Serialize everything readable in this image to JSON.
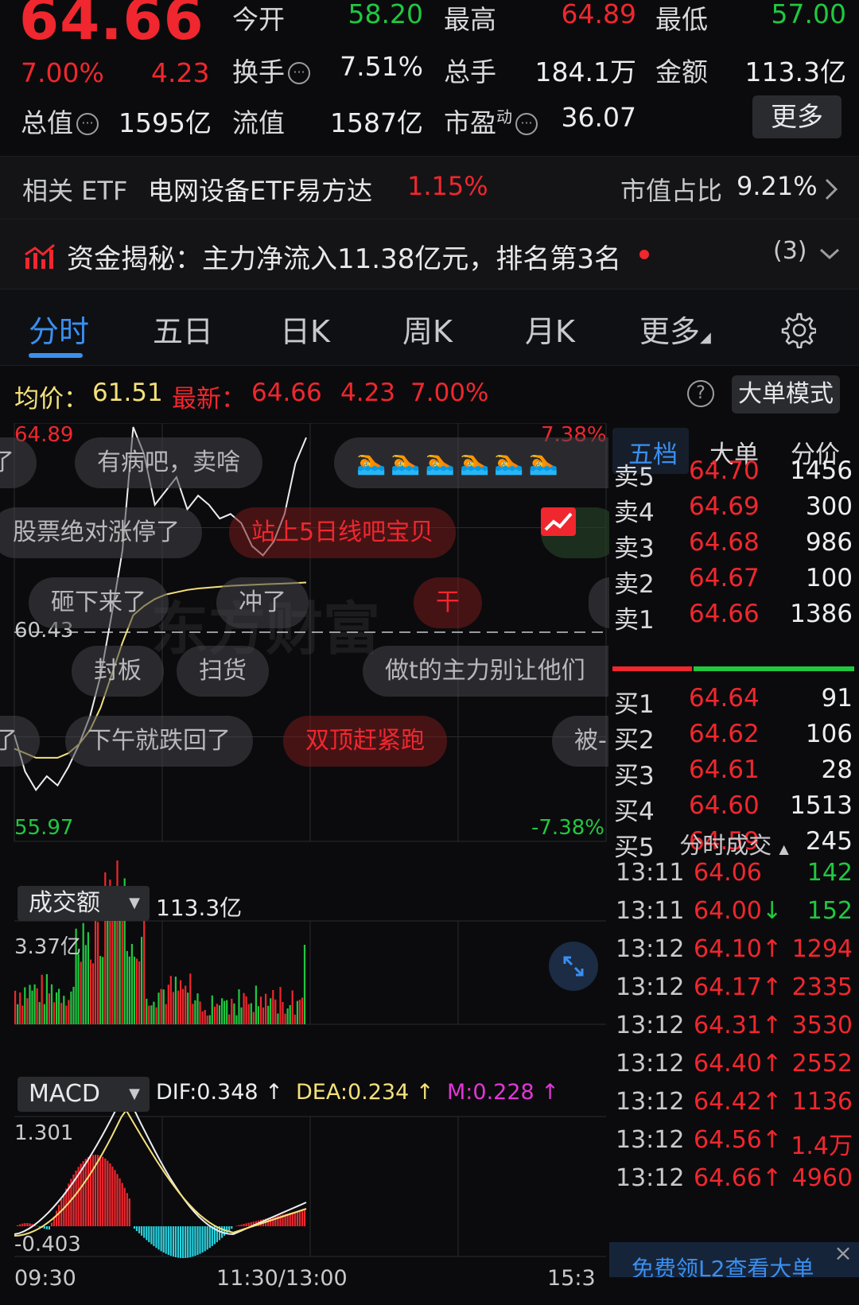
{
  "header": {
    "price": "64.66",
    "change_pct": "7.00%",
    "change_amt": "4.23",
    "row1": [
      {
        "label": "今开",
        "value": "58.20",
        "color": "green"
      },
      {
        "label": "最高",
        "value": "64.89",
        "color": "red"
      },
      {
        "label": "最低",
        "value": "57.00",
        "color": "green"
      }
    ],
    "row2": [
      {
        "label": "换手",
        "value": "7.51%",
        "color": "white"
      },
      {
        "label": "总手",
        "value": "184.1万",
        "color": "white"
      },
      {
        "label": "金额",
        "value": "113.3亿",
        "color": "white"
      }
    ],
    "row3": [
      {
        "label": "总值",
        "value": "1595亿",
        "color": "white"
      },
      {
        "label": "流值",
        "value": "1587亿",
        "color": "white"
      },
      {
        "label": "市盈",
        "sup": "动",
        "value": "36.07",
        "color": "white"
      }
    ],
    "more_label": "更多",
    "help_glyph": "···"
  },
  "etf": {
    "label": "相关 ETF",
    "name": "电网设备ETF易方达",
    "pct": "1.15%",
    "share_label": "市值占比",
    "share_value": "9.21%"
  },
  "fund_flow": {
    "text": "资金揭秘：主力净流入11.38亿元，排名第3名",
    "count": "(3)"
  },
  "tabs": [
    {
      "label": "分时",
      "active": true
    },
    {
      "label": "五日",
      "active": false
    },
    {
      "label": "日K",
      "active": false
    },
    {
      "label": "周K",
      "active": false
    },
    {
      "label": "月K",
      "active": false
    },
    {
      "label": "更多",
      "active": false
    }
  ],
  "stats": {
    "avg_label": "均价：",
    "avg_value": "61.51",
    "last_label": "最新：",
    "last_value": "64.66",
    "last_change": "4.23",
    "last_pct": "7.00%",
    "big_order_label": "大单模式"
  },
  "intraday": {
    "high_label": "64.89",
    "low_label": "55.97",
    "mid_label": "60.43",
    "top_pct": "7.38%",
    "bottom_pct": "-7.38%",
    "watermark": "东方财富",
    "price_series": [
      58.2,
      57.4,
      57.0,
      57.3,
      57.1,
      57.5,
      58.0,
      58.6,
      59.5,
      60.8,
      62.2,
      64.89,
      64.3,
      63.2,
      63.5,
      63.8,
      63.1,
      63.4,
      63.2,
      62.9,
      63.0,
      62.8,
      62.3,
      62.1,
      62.4,
      63.0,
      64.1,
      64.66
    ],
    "avg_series": [
      57.9,
      57.8,
      57.7,
      57.7,
      57.7,
      57.8,
      58.0,
      58.3,
      58.8,
      59.5,
      60.2,
      60.8,
      61.0,
      61.15,
      61.25,
      61.3,
      61.35,
      61.38,
      61.4,
      61.42,
      61.44,
      61.45,
      61.46,
      61.47,
      61.48,
      61.49,
      61.5,
      61.51
    ]
  },
  "danmaku": [
    {
      "text": "了",
      "hot": false
    },
    {
      "text": "有病吧，卖啥",
      "hot": false
    },
    {
      "text": "股票绝对涨停了",
      "hot": false
    },
    {
      "text": "站上5日线吧宝贝",
      "hot": true
    },
    {
      "text": "砸下来了",
      "hot": false
    },
    {
      "text": "冲了",
      "hot": false
    },
    {
      "text": "干",
      "hot": true
    },
    {
      "text": "封板",
      "hot": false
    },
    {
      "text": "扫货",
      "hot": false
    },
    {
      "text": "做t的主力别让他们",
      "hot": false
    },
    {
      "text": "了",
      "hot": false
    },
    {
      "text": "下午就跌回了",
      "hot": false
    },
    {
      "text": "双顶赶紧跑",
      "hot": true
    },
    {
      "text": "被-",
      "hot": false
    }
  ],
  "volume": {
    "selector": "成交额",
    "total": "113.3亿",
    "max_label": "3.37亿"
  },
  "macd": {
    "selector": "MACD",
    "dif": "DIF:0.348 ↑",
    "dea": "DEA:0.234 ↑",
    "m": "M:0.228 ↑",
    "max_label": "1.301",
    "min_label": "-0.403"
  },
  "time_axis": {
    "start": "09:30",
    "mid": "11:30/13:00",
    "end": "15:3"
  },
  "order_book": {
    "tabs": [
      "五档",
      "大单",
      "分价"
    ],
    "asks": [
      {
        "label": "卖5",
        "price": "64.70",
        "vol": "1456"
      },
      {
        "label": "卖4",
        "price": "64.69",
        "vol": "300"
      },
      {
        "label": "卖3",
        "price": "64.68",
        "vol": "986"
      },
      {
        "label": "卖2",
        "price": "64.67",
        "vol": "100"
      },
      {
        "label": "卖1",
        "price": "64.66",
        "vol": "1386"
      }
    ],
    "bids": [
      {
        "label": "买1",
        "price": "64.64",
        "vol": "91"
      },
      {
        "label": "买2",
        "price": "64.62",
        "vol": "106"
      },
      {
        "label": "买3",
        "price": "64.61",
        "vol": "28"
      },
      {
        "label": "买4",
        "price": "64.60",
        "vol": "1513"
      },
      {
        "label": "买5",
        "price": "64.59",
        "vol": "245"
      }
    ],
    "ticks_header": "分时成交",
    "ticks": [
      {
        "time": "13:11",
        "price": "64.06",
        "arrow": "",
        "vol": "142",
        "dir": "down"
      },
      {
        "time": "13:11",
        "price": "64.00",
        "arrow": "↓",
        "vol": "152",
        "dir": "down"
      },
      {
        "time": "13:12",
        "price": "64.10",
        "arrow": "↑",
        "vol": "1294",
        "dir": "up"
      },
      {
        "time": "13:12",
        "price": "64.17",
        "arrow": "↑",
        "vol": "2335",
        "dir": "up"
      },
      {
        "time": "13:12",
        "price": "64.31",
        "arrow": "↑",
        "vol": "3530",
        "dir": "up"
      },
      {
        "time": "13:12",
        "price": "64.40",
        "arrow": "↑",
        "vol": "2552",
        "dir": "up"
      },
      {
        "time": "13:12",
        "price": "64.42",
        "arrow": "↑",
        "vol": "1136",
        "dir": "up"
      },
      {
        "time": "13:12",
        "price": "64.56",
        "arrow": "↑",
        "vol": "1.4万",
        "dir": "up"
      },
      {
        "time": "13:12",
        "price": "64.66",
        "arrow": "↑",
        "vol": "4960",
        "dir": "up"
      }
    ],
    "promo": "免费领L2查看大单"
  },
  "colors": {
    "up": "#f0272e",
    "down": "#20c840",
    "accent": "#3a8ff0",
    "avg": "#f4e17a",
    "macd_neg": "#27d3e0"
  }
}
